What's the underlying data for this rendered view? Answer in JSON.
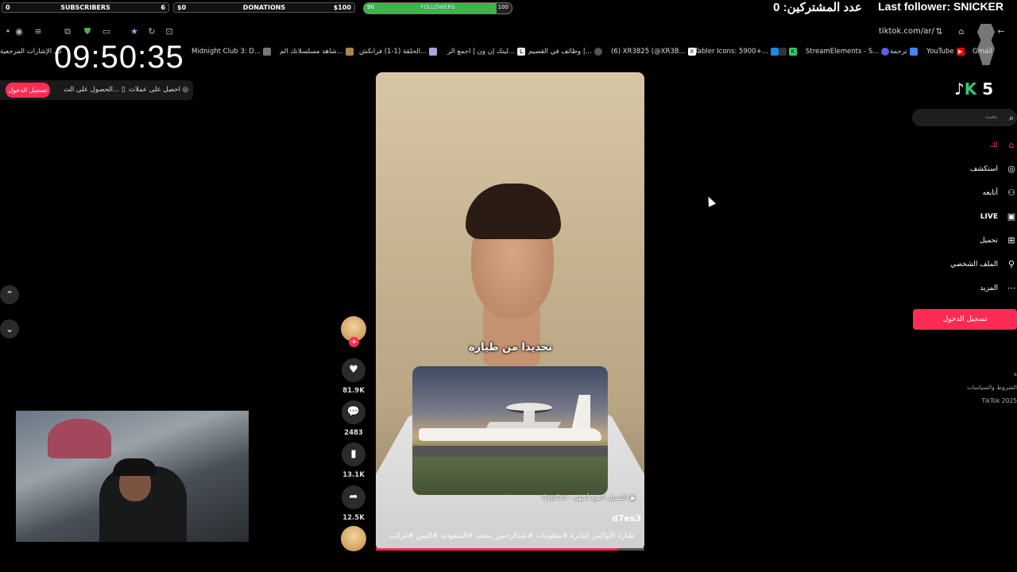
{
  "overlay": {
    "subs": {
      "left": "0",
      "label": "SUBSCRIBERS",
      "right": "6"
    },
    "donations": {
      "left": "$0",
      "label": "DONATIONS",
      "right": "$100"
    },
    "followers": {
      "left": "90",
      "label": "FOLLOWERS",
      "right": "100",
      "progress": 0.9
    },
    "subs_count_text": "عدد المشتركين: 0",
    "last_follower": "Last follower: SNICKER",
    "clock": "09:50:35"
  },
  "browser": {
    "url": "tiktok.com/ar/",
    "bookmarks": [
      "كل الإشارات المرجعية",
      "Midnight Club 3: D...",
      "شاهد مسلسلاتك الم...",
      "الحلقة (1-1) فرانكش...",
      "لينك إن ون | اجمع الر...",
      "وظائف في القصيم |...",
      "(6) XR3825 (@XR3B...",
      "Tabler Icons: 5900+...",
      "StreamElements - S...",
      "ترجمة",
      "YouTube",
      "Gmail"
    ]
  },
  "header": {
    "login": "تسجيل الدخول",
    "get_app": "الحصول على الت...",
    "get_coins": "احصل على عملات"
  },
  "video": {
    "caption": "تحديدا من طيارة",
    "capcut": "CapCut - التعديل أصبح أسهل",
    "author": "d7es3",
    "description": "طيارة الأواكس النادرة #معلومات #عبدالرحمن_محمد #السعودية #اليمن #غرائب",
    "progress": 0.9
  },
  "actions": {
    "likes": "81.9K",
    "comments": "2483",
    "saves": "13.1K",
    "shares": "12.5K"
  },
  "sidebar": {
    "logo_number": "5",
    "search_placeholder": "بحث",
    "items": [
      "لك",
      "استكشف",
      "أتابعه",
      "LIVE",
      "تحميل",
      "الملف الشخصي",
      "المزيد"
    ],
    "login": "تسجيل الدخول",
    "footer": [
      "ة",
      "الشروط والسياسات",
      "TikTok 2025"
    ]
  },
  "colors": {
    "accent": "#fe2c55",
    "followers_bar": "#3bb54a"
  }
}
